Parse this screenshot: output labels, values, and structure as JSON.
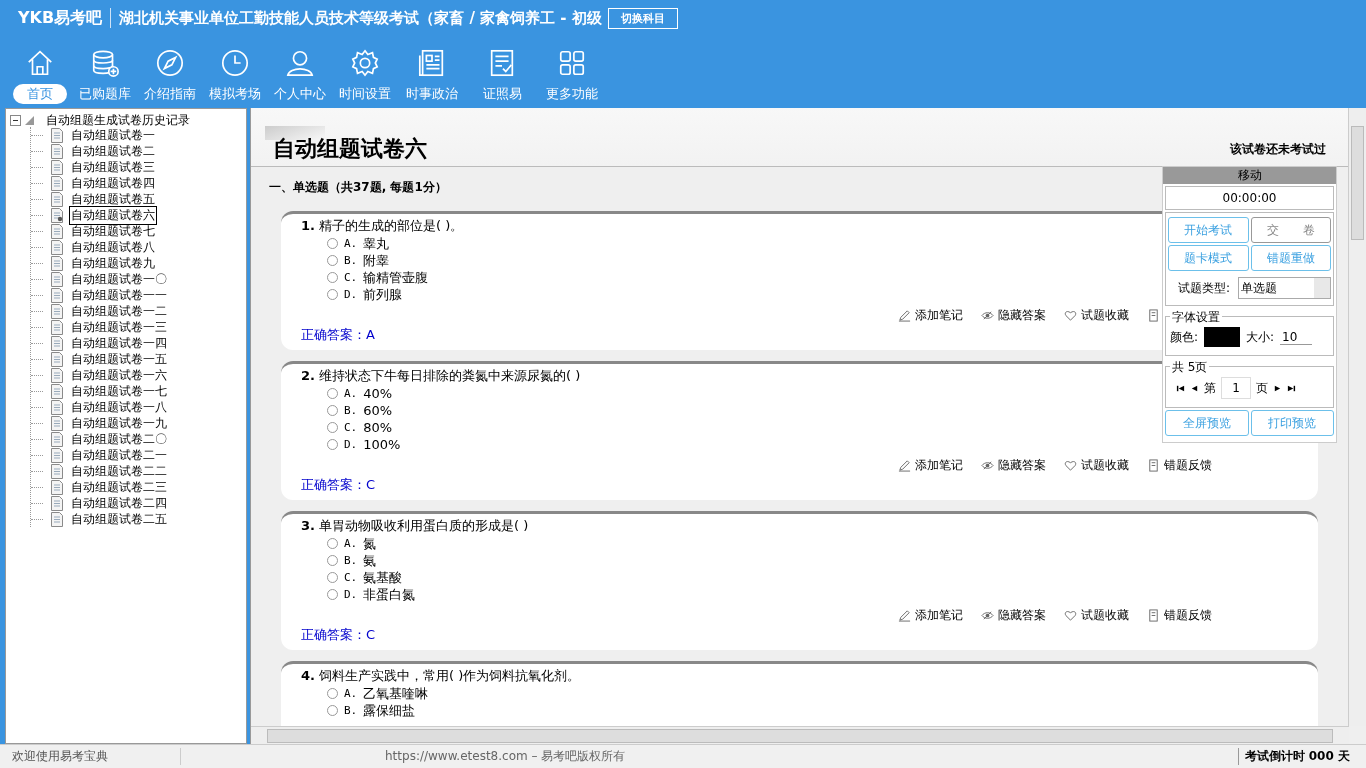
{
  "header": {
    "logo": "YKB易考吧",
    "title": "湖北机关事业单位工勤技能人员技术等级考试（家畜 / 家禽饲养工 - 初级",
    "switch_button": "切换科目"
  },
  "nav": [
    {
      "label": "首页",
      "kind": "home",
      "selected": true
    },
    {
      "label": "已购题库",
      "kind": "database",
      "selected": false
    },
    {
      "label": "介绍指南",
      "kind": "compass",
      "selected": false
    },
    {
      "label": "模拟考场",
      "kind": "clock",
      "selected": false
    },
    {
      "label": "个人中心",
      "kind": "person",
      "selected": false
    },
    {
      "label": "时间设置",
      "kind": "gear",
      "selected": false
    },
    {
      "label": "时事政治",
      "kind": "news",
      "selected": false
    },
    {
      "label": "证照易",
      "kind": "checklist",
      "selected": false
    },
    {
      "label": "更多功能",
      "kind": "grid",
      "selected": false
    }
  ],
  "tree": {
    "label": "自动组题生成试卷历史记录",
    "expanded": true,
    "children": [
      {
        "label": "自动组题试卷一",
        "selected": false
      },
      {
        "label": "自动组题试卷二",
        "selected": false
      },
      {
        "label": "自动组题试卷三",
        "selected": false
      },
      {
        "label": "自动组题试卷四",
        "selected": false
      },
      {
        "label": "自动组题试卷五",
        "selected": false
      },
      {
        "label": "自动组题试卷六",
        "selected": true
      },
      {
        "label": "自动组题试卷七",
        "selected": false
      },
      {
        "label": "自动组题试卷八",
        "selected": false
      },
      {
        "label": "自动组题试卷九",
        "selected": false
      },
      {
        "label": "自动组题试卷一〇",
        "selected": false
      },
      {
        "label": "自动组题试卷一一",
        "selected": false
      },
      {
        "label": "自动组题试卷一二",
        "selected": false
      },
      {
        "label": "自动组题试卷一三",
        "selected": false
      },
      {
        "label": "自动组题试卷一四",
        "selected": false
      },
      {
        "label": "自动组题试卷一五",
        "selected": false
      },
      {
        "label": "自动组题试卷一六",
        "selected": false
      },
      {
        "label": "自动组题试卷一七",
        "selected": false
      },
      {
        "label": "自动组题试卷一八",
        "selected": false
      },
      {
        "label": "自动组题试卷一九",
        "selected": false
      },
      {
        "label": "自动组题试卷二〇",
        "selected": false
      },
      {
        "label": "自动组题试卷二一",
        "selected": false
      },
      {
        "label": "自动组题试卷二二",
        "selected": false
      },
      {
        "label": "自动组题试卷二三",
        "selected": false
      },
      {
        "label": "自动组题试卷二四",
        "selected": false
      },
      {
        "label": "自动组题试卷二五",
        "selected": false
      }
    ]
  },
  "paper": {
    "title": "自动组题试卷六",
    "status": "该试卷还未考试过",
    "section": "一、单选题（共37题, 每题1分）"
  },
  "questions": [
    {
      "number": "1.",
      "text": "精子的生成的部位是( )。",
      "options": [
        {
          "letter": "A.",
          "text": "睾丸",
          "selected": false
        },
        {
          "letter": "B.",
          "text": "附睾",
          "selected": false
        },
        {
          "letter": "C.",
          "text": "输精管壶腹",
          "selected": false
        },
        {
          "letter": "D.",
          "text": "前列腺",
          "selected": false
        }
      ],
      "answer": "正确答案：A",
      "actions": [
        {
          "kind": "note",
          "label": "添加笔记"
        },
        {
          "kind": "hide",
          "label": "隐藏答案"
        },
        {
          "kind": "favorite",
          "label": "试题收藏"
        },
        {
          "kind": "feedback"
        }
      ]
    },
    {
      "number": "2.",
      "text": "维持状态下牛每日排除的粪氮中来源尿氮的( )",
      "options": [
        {
          "letter": "A.",
          "text": "40%",
          "selected": false
        },
        {
          "letter": "B.",
          "text": "60%",
          "selected": false
        },
        {
          "letter": "C.",
          "text": "80%",
          "selected": false
        },
        {
          "letter": "D.",
          "text": "100%",
          "selected": false
        }
      ],
      "answer": "正确答案：C",
      "actions": [
        {
          "kind": "note",
          "label": "添加笔记"
        },
        {
          "kind": "hide",
          "label": "隐藏答案"
        },
        {
          "kind": "favorite",
          "label": "试题收藏"
        },
        {
          "kind": "feedback",
          "label": "错题反馈"
        }
      ]
    },
    {
      "number": "3.",
      "text": "单胃动物吸收利用蛋白质的形成是( )",
      "options": [
        {
          "letter": "A.",
          "text": "氮",
          "selected": false
        },
        {
          "letter": "B.",
          "text": "氨",
          "selected": false
        },
        {
          "letter": "C.",
          "text": "氨基酸",
          "selected": false
        },
        {
          "letter": "D.",
          "text": "非蛋白氮",
          "selected": false
        }
      ],
      "answer": "正确答案：C",
      "actions": [
        {
          "kind": "note",
          "label": "添加笔记"
        },
        {
          "kind": "hide",
          "label": "隐藏答案"
        },
        {
          "kind": "favorite",
          "label": "试题收藏"
        },
        {
          "kind": "feedback",
          "label": "错题反馈"
        }
      ]
    },
    {
      "number": "4.",
      "text": "饲料生产实践中，常用( )作为饲料抗氧化剂。",
      "options": [
        {
          "letter": "A.",
          "text": "乙氧基喹啉",
          "selected": false
        },
        {
          "letter": "B.",
          "text": "露保细盐",
          "selected": false
        }
      ]
    }
  ],
  "panel": {
    "move": "移动",
    "timer": "00:00:00",
    "start_button": "开始考试",
    "submit_button": "交　　卷",
    "card_button": "题卡模式",
    "redo_button": "错题重做",
    "type_label": "试题类型:",
    "type_value": "单选题",
    "font_legend": "字体设置",
    "color_label": "颜色:",
    "color": "#000000",
    "size_label": "大小:",
    "size_value": "10",
    "pages_legend": "共 5页",
    "page_prefix": "第",
    "page_value": "1",
    "page_suffix": "页",
    "fullscreen_button": "全屏预览",
    "print_button": "打印预览"
  },
  "status_bar": {
    "welcome": "欢迎使用易考宝典",
    "copyright": "https://www.etest8.com – 易考吧版权所有",
    "countdown": "考试倒计时 000 天"
  }
}
